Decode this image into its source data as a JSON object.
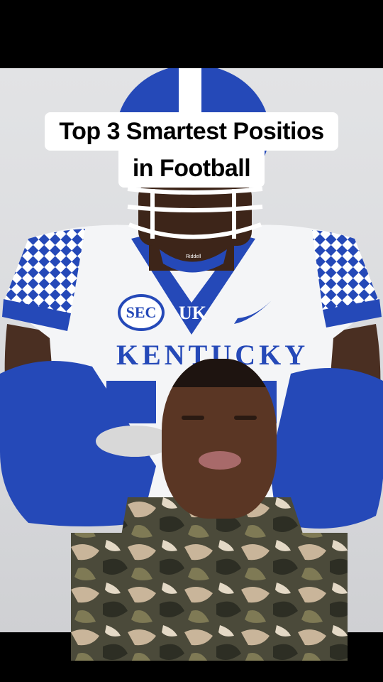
{
  "caption": {
    "line1": "Top 3  Smartest Positios",
    "line2": "in Football"
  },
  "jersey": {
    "conference_patch": "SEC",
    "team_logo": "UK",
    "team_name": "KENTUCKY",
    "helmet_brand": "Riddell"
  },
  "colors": {
    "kentucky_blue": "#2549b8",
    "jersey_white": "#f4f5f7",
    "background": "#dcdde0"
  }
}
